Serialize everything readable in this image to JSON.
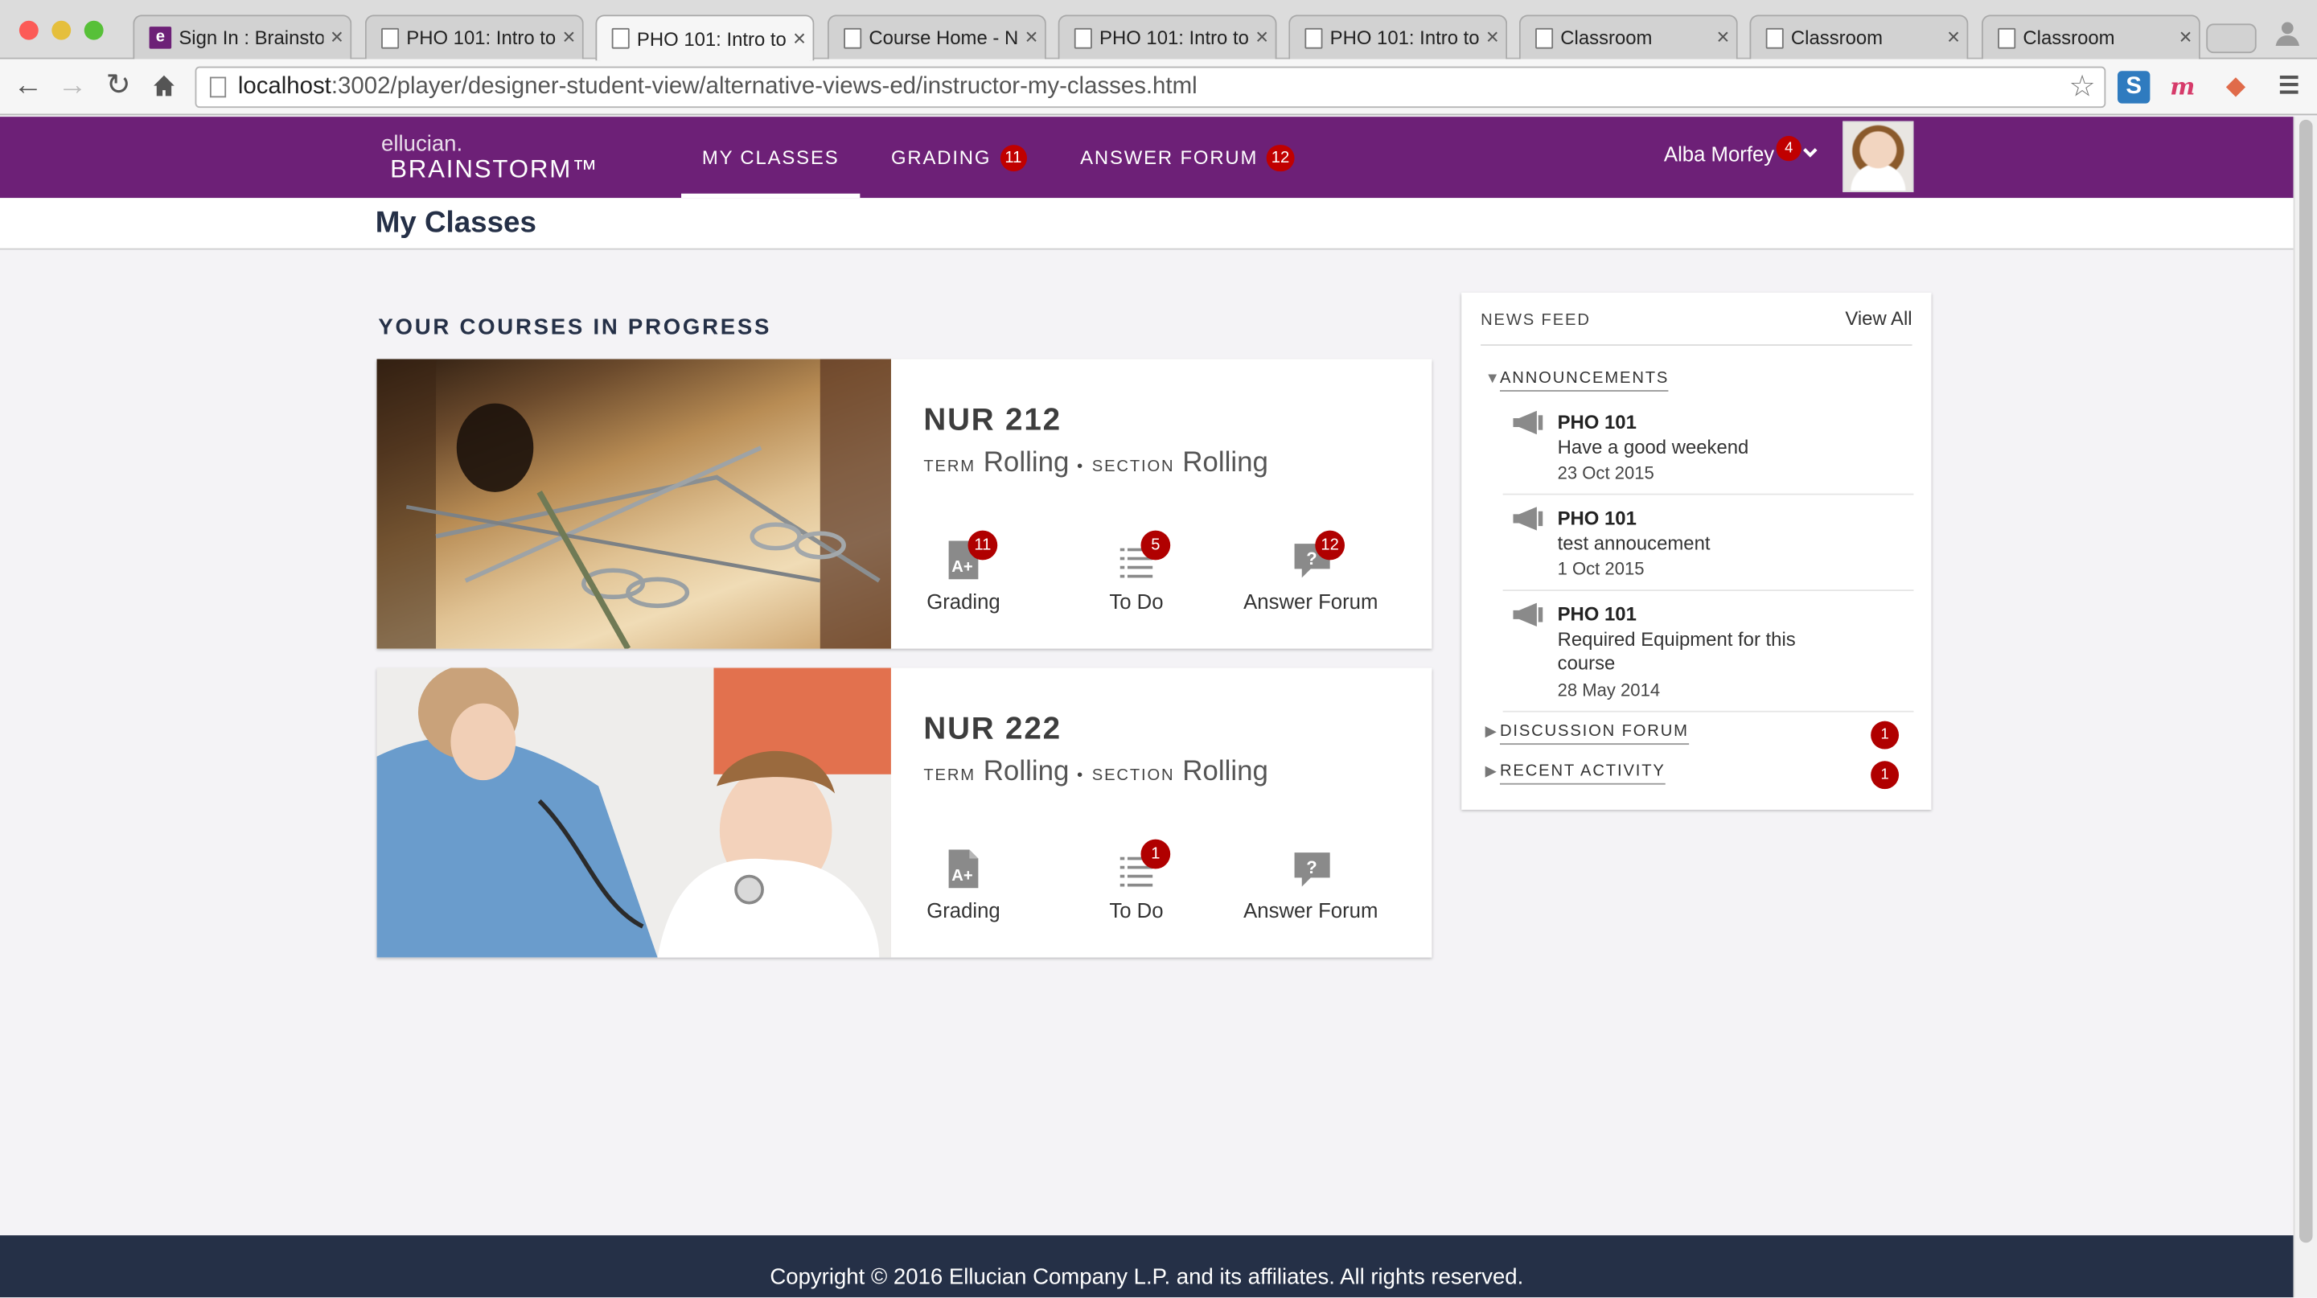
{
  "browser": {
    "tabs": [
      {
        "title": "Sign In : Brainstorm",
        "favicon": "ellucian-e-icon"
      },
      {
        "title": "PHO 101: Intro to",
        "favicon": "page-icon"
      },
      {
        "title": "PHO 101: Intro to",
        "favicon": "page-icon"
      },
      {
        "title": "Course Home - N",
        "favicon": "page-icon"
      },
      {
        "title": "PHO 101: Intro to",
        "favicon": "page-icon"
      },
      {
        "title": "PHO 101: Intro to",
        "favicon": "page-icon"
      },
      {
        "title": "Classroom",
        "favicon": "page-icon"
      },
      {
        "title": "Classroom",
        "favicon": "page-icon"
      },
      {
        "title": "Classroom",
        "favicon": "page-icon"
      }
    ],
    "active_tab_index": 2,
    "url_host": "localhost",
    "url_rest": ":3002/player/designer-student-view/alternative-views-ed/instructor-my-classes.html"
  },
  "header": {
    "logo_line1": "ellucian.",
    "logo_line2": "BRAINSTORM™",
    "nav": [
      {
        "label": "MY CLASSES",
        "badge": null,
        "active": true
      },
      {
        "label": "GRADING",
        "badge": "11",
        "active": false
      },
      {
        "label": "ANSWER FORUM",
        "badge": "12",
        "active": false
      }
    ],
    "user_name": "Alba Morfey",
    "user_badge": "4"
  },
  "page": {
    "title": "My Classes",
    "courses_heading": "YOUR COURSES IN PROGRESS"
  },
  "courses": [
    {
      "code": "NUR 212",
      "term_label": "TERM",
      "term": "Rolling",
      "separator": "•",
      "section_label": "SECTION",
      "section": "Rolling",
      "actions": [
        {
          "label": "Grading",
          "badge": "11",
          "icon": "grade-document-icon"
        },
        {
          "label": "To Do",
          "badge": "5",
          "icon": "todo-list-icon"
        },
        {
          "label": "Answer Forum",
          "badge": "12",
          "icon": "question-bubble-icon"
        }
      ]
    },
    {
      "code": "NUR 222",
      "term_label": "TERM",
      "term": "Rolling",
      "separator": "•",
      "section_label": "SECTION",
      "section": "Rolling",
      "actions": [
        {
          "label": "Grading",
          "badge": null,
          "icon": "grade-document-icon"
        },
        {
          "label": "To Do",
          "badge": "1",
          "icon": "todo-list-icon"
        },
        {
          "label": "Answer Forum",
          "badge": null,
          "icon": "question-bubble-icon"
        }
      ]
    }
  ],
  "news_feed": {
    "title": "NEWS FEED",
    "view_all": "View All",
    "announcements_label": "ANNOUNCEMENTS",
    "announcements": [
      {
        "course": "PHO 101",
        "text": "Have a good weekend",
        "date": "23 Oct 2015"
      },
      {
        "course": "PHO 101",
        "text": "test annoucement",
        "date": "1 Oct 2015"
      },
      {
        "course": "PHO 101",
        "text": "Required Equipment for this course",
        "date": "28 May 2014"
      }
    ],
    "discussion_label": "DISCUSSION FORUM",
    "discussion_badge": "1",
    "activity_label": "RECENT ACTIVITY",
    "activity_badge": "1"
  },
  "footer": {
    "text": "Copyright © 2016 Ellucian Company L.P. and its affiliates. All rights reserved."
  },
  "colors": {
    "brand_purple": "#6d2077",
    "navy": "#253047",
    "badge_red": "#b00000"
  }
}
